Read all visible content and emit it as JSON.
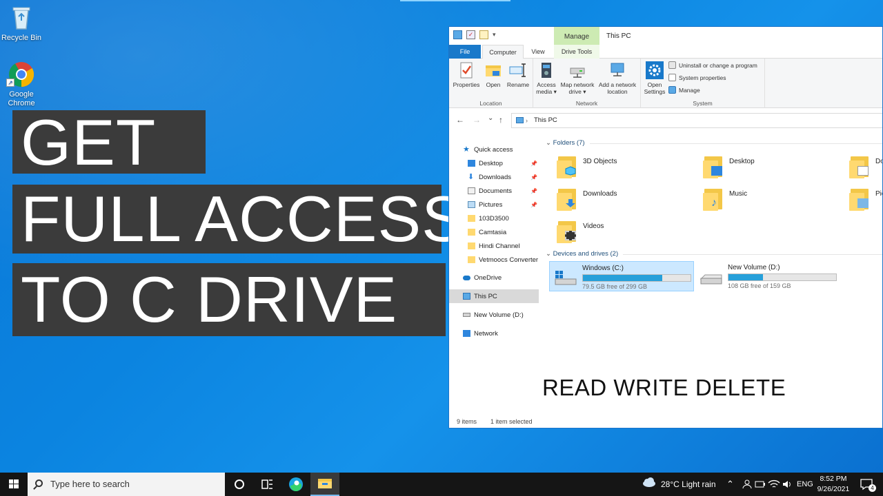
{
  "desktop": {
    "icons": [
      {
        "label": "Recycle Bin",
        "icon": "recycle-bin-icon"
      },
      {
        "label": "Google Chrome",
        "icon": "chrome-icon"
      }
    ],
    "banner": [
      "GET",
      "FULL ACCESS",
      "TO C DRIVE"
    ],
    "overlay_caption": "READ WRITE DELETE"
  },
  "explorer": {
    "title": "This PC",
    "context_tab": "Manage",
    "tabs": {
      "file": "File",
      "computer": "Computer",
      "view": "View",
      "drive_tools": "Drive Tools"
    },
    "ribbon": {
      "location": {
        "label": "Location",
        "buttons": [
          "Properties",
          "Open",
          "Rename"
        ]
      },
      "network": {
        "label": "Network",
        "access_media": [
          "Access",
          "media ▾"
        ],
        "map_network_drive": [
          "Map network",
          "drive ▾"
        ],
        "add_network_location": [
          "Add a network",
          "location"
        ]
      },
      "system": {
        "label": "System",
        "open_settings": [
          "Open",
          "Settings"
        ],
        "items": [
          "Uninstall or change a program",
          "System properties",
          "Manage"
        ]
      }
    },
    "address": {
      "path": "This PC",
      "nav": {
        "back": "←",
        "forward": "→",
        "recent": "⌄",
        "up": "↑"
      }
    },
    "nav_pane": {
      "quick_access": "Quick access",
      "pinned": [
        "Desktop",
        "Downloads",
        "Documents",
        "Pictures"
      ],
      "recent": [
        "103D3500",
        "Camtasia",
        "Hindi Channel",
        "Vetmoocs Converter"
      ],
      "onedrive": "OneDrive",
      "this_pc": "This PC",
      "new_volume": "New Volume (D:)",
      "network": "Network",
      "pin_glyph": "📌"
    },
    "folders": {
      "heading": "Folders (7)",
      "items": [
        "3D Objects",
        "Desktop",
        "Documents",
        "Downloads",
        "Music",
        "Pictures",
        "Videos"
      ]
    },
    "drives": {
      "heading": "Devices and drives (2)",
      "items": [
        {
          "name": "Windows (C:)",
          "free": "79.5 GB free of 299 GB",
          "used_fraction": 0.734
        },
        {
          "name": "New Volume (D:)",
          "free": "108 GB free of 159 GB",
          "used_fraction": 0.321
        }
      ]
    },
    "status": {
      "items": "9 items",
      "selected": "1 item selected"
    }
  },
  "taskbar": {
    "search_placeholder": "Type here to search",
    "weather": "28°C  Light rain",
    "language": "ENG",
    "time": "8:52 PM",
    "date": "9/26/2021",
    "notification_count": "4"
  },
  "colors": {
    "accent": "#1979ca",
    "drive_bar": "#26a0da",
    "banner_bg": "#3b3b3b",
    "manage_tab": "#cdebb3"
  }
}
